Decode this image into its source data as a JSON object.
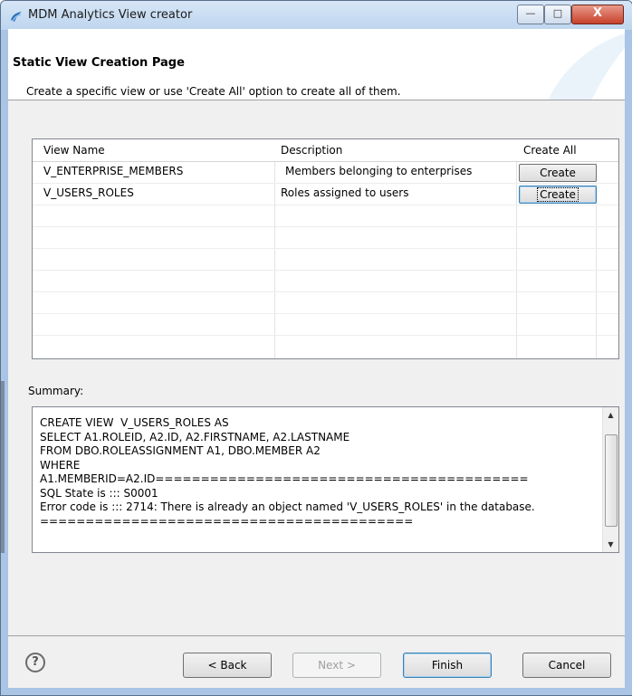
{
  "window": {
    "title": "MDM Analytics View creator",
    "minimize_glyph": "—",
    "maximize_glyph": "□",
    "close_glyph": "X"
  },
  "header": {
    "title": "Static View Creation Page",
    "subtitle": "Create a specific view or use 'Create All' option to create all of them."
  },
  "table": {
    "columns": [
      "View Name",
      "Description",
      "Create All"
    ],
    "rows": [
      {
        "name": "V_ENTERPRISE_MEMBERS",
        "description": "Members belonging to enterprises",
        "action": "Create"
      },
      {
        "name": "V_USERS_ROLES",
        "description": "Roles assigned to users",
        "action": "Create"
      }
    ]
  },
  "summary": {
    "label": "Summary:",
    "text": "CREATE VIEW  V_USERS_ROLES AS\nSELECT A1.ROLEID, A2.ID, A2.FIRSTNAME, A2.LASTNAME\nFROM DBO.ROLEASSIGNMENT A1, DBO.MEMBER A2\nWHERE\nA1.MEMBERID=A2.ID=========================================\nSQL State is ::: S0001\nError code is ::: 2714: There is already an object named 'V_USERS_ROLES' in the database.\n========================================="
  },
  "buttons": {
    "help": "?",
    "back": "< Back",
    "next": "Next >",
    "finish": "Finish",
    "cancel": "Cancel"
  },
  "icons": {
    "app": "app-icon",
    "help": "help-icon"
  }
}
